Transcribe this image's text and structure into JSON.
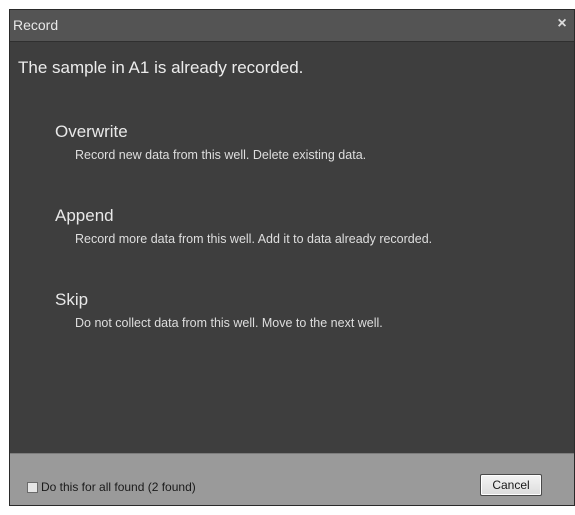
{
  "window": {
    "title": "Record",
    "close_symbol": "×"
  },
  "message": "The sample in A1 is already recorded.",
  "options": [
    {
      "title": "Overwrite",
      "description": "Record new data from this well. Delete existing data."
    },
    {
      "title": "Append",
      "description": "Record more data from this well. Add it to data already recorded."
    },
    {
      "title": "Skip",
      "description": "Do not collect data from this well. Move to the next well."
    }
  ],
  "footer": {
    "checkbox_label": "Do this for all found (2 found)",
    "checkbox_checked": false,
    "cancel_label": "Cancel"
  },
  "colors": {
    "dialog_bg": "#3e3e3e",
    "titlebar_bg": "#545454",
    "footer_bg": "#9a9a9a"
  }
}
